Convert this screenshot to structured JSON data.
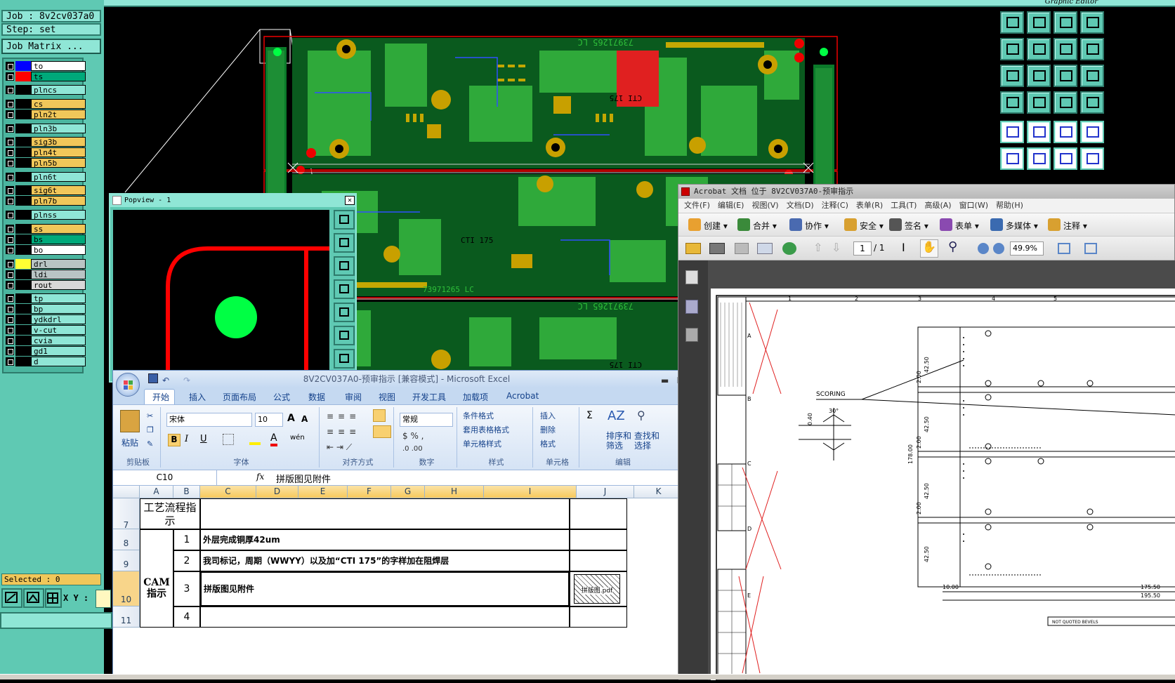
{
  "cam": {
    "job_label": "Job : 8v2cv037a0",
    "step_label": "Step: set",
    "job_matrix_button": "Job Matrix ...",
    "layers": [
      {
        "name": "to",
        "swatch": "#0000ff",
        "color": "#ffffff"
      },
      {
        "name": "ts",
        "swatch": "#ff0000",
        "color": "#00a97a"
      },
      {
        "name": "plncs",
        "swatch": "#000000",
        "color": "#8fe6d6"
      },
      {
        "name": "cs",
        "swatch": "#000000",
        "color": "#f0c75a"
      },
      {
        "name": "pln2t",
        "swatch": "#000000",
        "color": "#f0c75a"
      },
      {
        "name": "pln3b",
        "swatch": "#000000",
        "color": "#8fe6d6"
      },
      {
        "name": "sig3b",
        "swatch": "#000000",
        "color": "#f0c75a"
      },
      {
        "name": "pln4t",
        "swatch": "#000000",
        "color": "#f0c75a"
      },
      {
        "name": "pln5b",
        "swatch": "#000000",
        "color": "#f0c75a"
      },
      {
        "name": "pln6t",
        "swatch": "#000000",
        "color": "#8fe6d6"
      },
      {
        "name": "sig6t",
        "swatch": "#000000",
        "color": "#f0c75a"
      },
      {
        "name": "pln7b",
        "swatch": "#000000",
        "color": "#f0c75a"
      },
      {
        "name": "plnss",
        "swatch": "#000000",
        "color": "#8fe6d6"
      },
      {
        "name": "ss",
        "swatch": "#000000",
        "color": "#f0c75a"
      },
      {
        "name": "bs",
        "swatch": "#000000",
        "color": "#00a97a"
      },
      {
        "name": "bo",
        "swatch": "#000000",
        "color": "#ffffff"
      },
      {
        "name": "drl",
        "swatch": "#ffff33",
        "color": "#b9c4c4"
      },
      {
        "name": "ldi",
        "swatch": "#000000",
        "color": "#b9c4c4"
      },
      {
        "name": "rout",
        "swatch": "#000000",
        "color": "#d8d8d8"
      },
      {
        "name": "tp",
        "swatch": "#000000",
        "color": "#8fe6d6"
      },
      {
        "name": "bp",
        "swatch": "#000000",
        "color": "#8fe6d6"
      },
      {
        "name": "ydkdrl",
        "swatch": "#000000",
        "color": "#8fe6d6"
      },
      {
        "name": "v-cut",
        "swatch": "#000000",
        "color": "#8fe6d6"
      },
      {
        "name": "cvia",
        "swatch": "#000000",
        "color": "#8fe6d6"
      },
      {
        "name": "gd1",
        "swatch": "#000000",
        "color": "#8fe6d6"
      },
      {
        "name": "d",
        "swatch": "#000000",
        "color": "#8fe6d6"
      }
    ],
    "selected_label": "Selected : 0",
    "xy_label": "X Y :",
    "editor_title": "Graphic Editor",
    "popview_title": "Popview - 1",
    "pcb_labels": [
      "73971265 LC",
      "73971265 LC",
      "73971265 LC",
      "CTI 175",
      "CTI 175",
      "CTI 175"
    ]
  },
  "acrobat": {
    "title": "Acrobat 文档 位于 8V2CV037A0-预审指示",
    "menu": [
      "文件(F)",
      "编辑(E)",
      "视图(V)",
      "文档(D)",
      "注释(C)",
      "表单(R)",
      "工具(T)",
      "高级(A)",
      "窗口(W)",
      "帮助(H)"
    ],
    "toolbar": [
      "创建",
      "合并",
      "协作",
      "安全",
      "签名",
      "表单",
      "多媒体",
      "注释"
    ],
    "page_current": "1",
    "page_total": "/ 1",
    "zoom": "49.9%",
    "drawing": {
      "ruler": [
        "1",
        "2",
        "3",
        "4",
        "5"
      ],
      "row_letters": [
        "A",
        "B",
        "C",
        "D",
        "E"
      ],
      "scoring": "SCORING",
      "angle": "30°",
      "dims": [
        "42.50",
        "2.00",
        "42.50",
        "2.00",
        "42.50",
        "2.00",
        "42.50",
        "178.00",
        "175.50",
        "195.50",
        "10.00",
        "0.40"
      ],
      "footer": "NOT QUOTED BEVELS"
    }
  },
  "excel": {
    "title": "8V2CV037A0-预审指示 [兼容模式] - Microsoft Excel",
    "tabs": [
      "开始",
      "插入",
      "页面布局",
      "公式",
      "数据",
      "审阅",
      "视图",
      "开发工具",
      "加载项",
      "Acrobat"
    ],
    "ribbon": {
      "paste": "粘贴",
      "clipboard": "剪贴板",
      "font_name": "宋体",
      "font_size": "10",
      "font_group": "字体",
      "align_group": "对齐方式",
      "number_format": "常规",
      "number_group": "数字",
      "cond_format": "条件格式",
      "table_format": "套用表格格式",
      "cell_style": "单元格样式",
      "style_group": "样式",
      "insert": "插入",
      "delete": "删除",
      "format": "格式",
      "cells_group": "单元格",
      "sort_filter": "排序和\n筛选",
      "find_select": "查找和\n选择",
      "edit_group": "编辑"
    },
    "name_box": "C10",
    "formula": "拼版图见附件",
    "columns": [
      "A",
      "B",
      "C",
      "D",
      "E",
      "F",
      "G",
      "H",
      "I",
      "J",
      "K"
    ],
    "rows": [
      {
        "num": "7",
        "a": "工艺流程指示",
        "b": "",
        "c": ""
      },
      {
        "num": "8",
        "a": "",
        "b": "1",
        "c": "外层完成铜厚42um"
      },
      {
        "num": "9",
        "a": "",
        "b": "2",
        "c": "我司标记，周期（WWYY）以及加“CTI 175”的字样加在阻焊层"
      },
      {
        "num": "10",
        "a": "",
        "b": "3",
        "c": "拼版图见附件"
      },
      {
        "num": "11",
        "a": "CAM指示",
        "b": "4",
        "c": ""
      }
    ],
    "attachment_label": "拼版图.pdf"
  }
}
